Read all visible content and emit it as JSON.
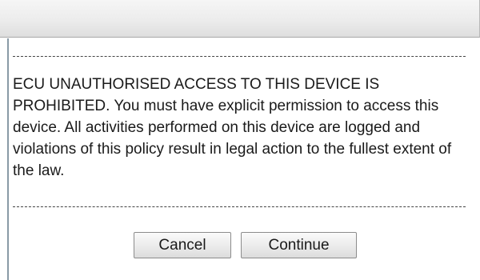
{
  "dialog": {
    "title": "",
    "message": "ECU UNAUTHORISED ACCESS TO THIS DEVICE IS PROHIBITED. You must have explicit permission to access this device. All activities performed on this device are logged and violations of this policy result in legal action to the fullest extent of the law.",
    "cancel_label": "Cancel",
    "continue_label": "Continue"
  },
  "colors": {
    "titlebar": "#ececec",
    "frame_border": "#8a9aa6",
    "text": "#1a1a1a"
  }
}
